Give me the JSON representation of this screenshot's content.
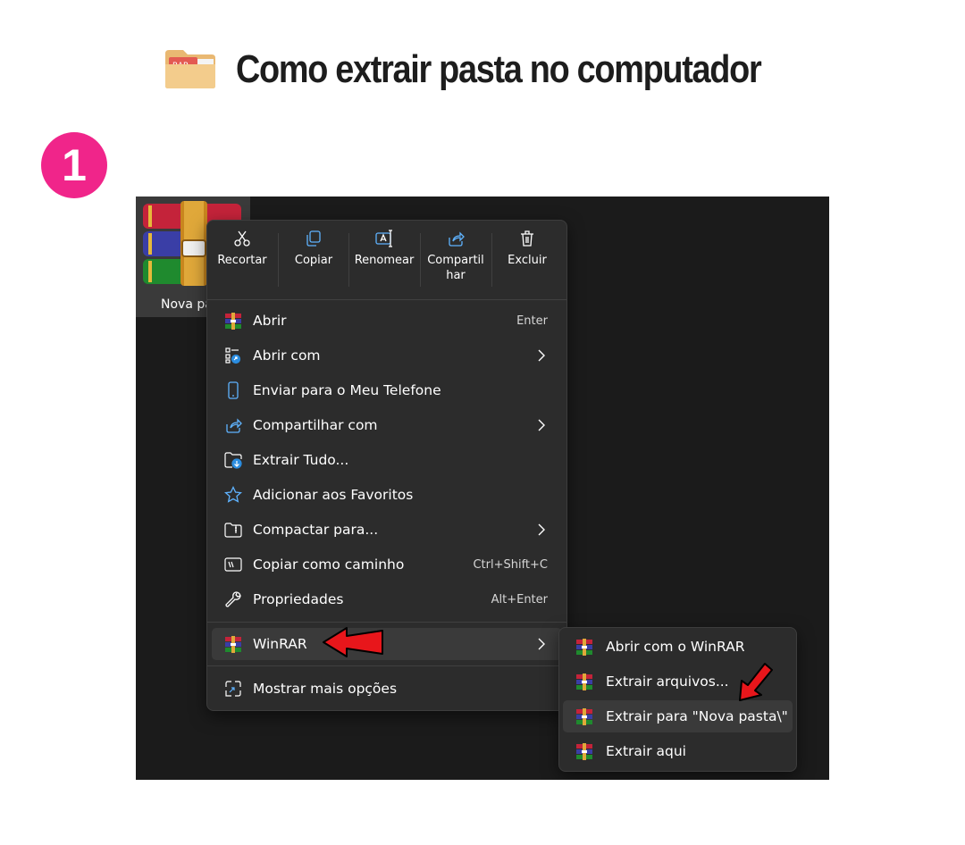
{
  "header": {
    "title": "Como extrair pasta no computador",
    "folder_badge": "RAR"
  },
  "step": {
    "number": "1"
  },
  "file": {
    "label": "Nova pa"
  },
  "toolbar": [
    {
      "label": "Recortar",
      "icon": "scissors-icon"
    },
    {
      "label": "Copiar",
      "icon": "copy-icon"
    },
    {
      "label": "Renomear",
      "icon": "rename-icon"
    },
    {
      "label": "Compartil har",
      "icon": "share-icon"
    },
    {
      "label": "Excluir",
      "icon": "trash-icon"
    }
  ],
  "menu": {
    "items": [
      {
        "label": "Abrir",
        "shortcut": "Enter",
        "icon": "winrar-icon"
      },
      {
        "label": "Abrir com",
        "shortcut": "",
        "icon": "open-with-icon",
        "submenu": true
      },
      {
        "label": "Enviar para o Meu Telefone",
        "shortcut": "",
        "icon": "phone-icon"
      },
      {
        "label": "Compartilhar com",
        "shortcut": "",
        "icon": "share-icon",
        "submenu": true
      },
      {
        "label": "Extrair Tudo...",
        "shortcut": "",
        "icon": "extract-folder-icon"
      },
      {
        "label": "Adicionar aos Favoritos",
        "shortcut": "",
        "icon": "star-icon"
      },
      {
        "label": "Compactar para...",
        "shortcut": "",
        "icon": "zip-folder-icon",
        "submenu": true
      },
      {
        "label": "Copiar como caminho",
        "shortcut": "Ctrl+Shift+C",
        "icon": "copy-path-icon"
      },
      {
        "label": "Propriedades",
        "shortcut": "Alt+Enter",
        "icon": "wrench-icon"
      }
    ],
    "winrar": {
      "label": "WinRAR",
      "icon": "winrar-icon"
    },
    "more": {
      "label": "Mostrar mais opções",
      "icon": "more-options-icon"
    }
  },
  "submenu": {
    "items": [
      {
        "label": "Abrir com o WinRAR",
        "icon": "winrar-icon"
      },
      {
        "label": "Extrair arquivos...",
        "icon": "winrar-icon"
      },
      {
        "label": "Extrair para \"Nova pasta\\\"",
        "icon": "winrar-icon"
      },
      {
        "label": "Extrair aqui",
        "icon": "winrar-icon"
      }
    ]
  },
  "colors": {
    "accent_pink": "#f0258a",
    "menu_bg": "#2c2c2c",
    "highlight": "#3a3a3a",
    "arrow_red": "#e8161b"
  }
}
